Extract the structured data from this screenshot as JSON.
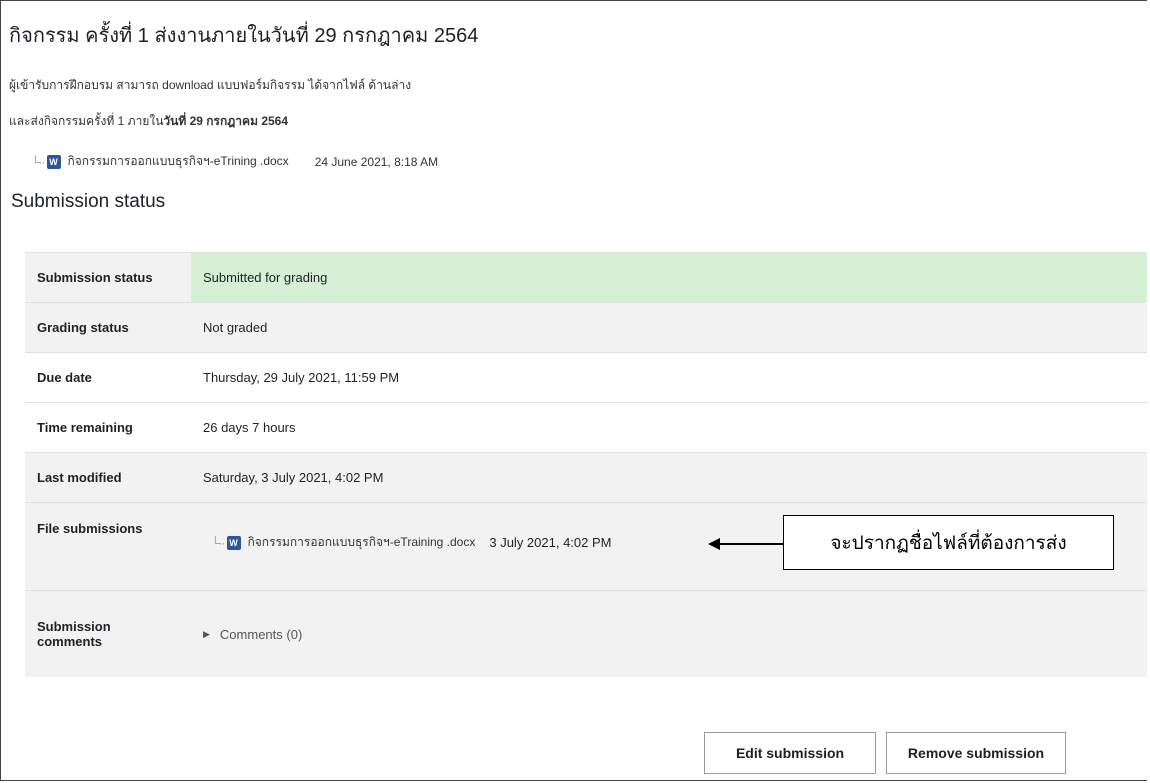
{
  "activity": {
    "title": "กิจกรรม ครั้งที่ 1 ส่งงานภายในวันที่ 29 กรกฎาคม 2564",
    "description_1": "ผู้เข้ารับการฝึกอบรม สามารถ download แบบฟอร์มกิจรรม ได้จากไฟล์ ด้านล่าง",
    "description_2_prefix": "และส่งกิจกรรมครั้งที่ 1 ภายใน",
    "description_2_bold": "วันที่ 29 กรกฎาคม 2564",
    "attachment": {
      "name": "กิจกรรมการออกแบบธุรกิจฯ-eTrining .docx",
      "date": "24 June 2021, 8:18 AM",
      "icon": "word-doc-icon"
    }
  },
  "submission": {
    "heading": "Submission status",
    "rows": [
      {
        "label": "Submission status",
        "value": "Submitted for grading"
      },
      {
        "label": "Grading status",
        "value": "Not graded"
      },
      {
        "label": "Due date",
        "value": "Thursday, 29 July 2021, 11:59 PM"
      },
      {
        "label": "Time remaining",
        "value": "26 days 7 hours"
      },
      {
        "label": "Last modified",
        "value": "Saturday, 3 July 2021, 4:02 PM"
      }
    ],
    "files_label": "File submissions",
    "file": {
      "name": "กิจกรรมการออกแบบธุรกิจฯ-eTraining .docx",
      "date": "3 July 2021, 4:02 PM",
      "icon": "word-doc-icon"
    },
    "comments_label_1": "Submission",
    "comments_label_2": "comments",
    "comments_link": "Comments (0)"
  },
  "annotation": {
    "text": "จะปรากฏชื่อไฟล์ที่ต้องการส่ง"
  },
  "buttons": {
    "edit": "Edit submission",
    "remove": "Remove submission"
  },
  "colors": {
    "success_bg": "#d6f0d6",
    "stripe_bg": "#f2f2f2",
    "word_icon": "#2b579a"
  }
}
